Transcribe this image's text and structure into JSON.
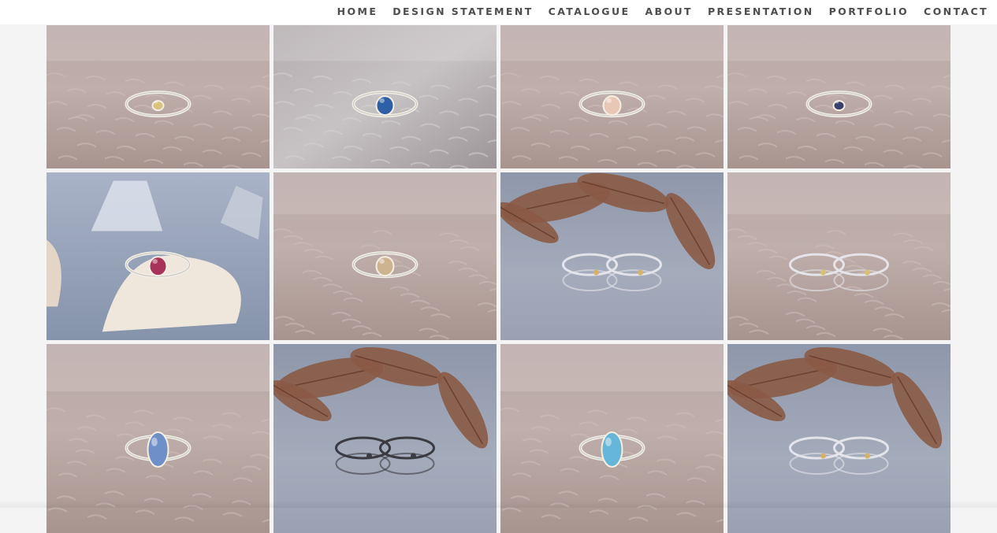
{
  "nav": {
    "items": [
      {
        "label": "HOME"
      },
      {
        "label": "DESIGN STATEMENT"
      },
      {
        "label": "CATALOGUE"
      },
      {
        "label": "ABOUT"
      },
      {
        "label": "PRESENTATION"
      },
      {
        "label": "PORTFOLIO"
      },
      {
        "label": "CONTACT"
      }
    ],
    "text_color": "#4d4d4d"
  },
  "gallery": {
    "tiles": [
      {
        "subject": "thin gold ring with small yellow stone on fur",
        "background": "fur",
        "stone": "#d9c27a"
      },
      {
        "subject": "double silver ring with blue pear stone on grey fur",
        "background": "grey-fur",
        "stone": "#2f5fa6"
      },
      {
        "subject": "split shank ring with peach stone on fur",
        "background": "fur",
        "stone": "#e9c7b5"
      },
      {
        "subject": "thin ring with dark blue oval stone on fur",
        "background": "fur",
        "stone": "#3b3f6e"
      },
      {
        "subject": "ring with pink stone on dried leaf with crystals",
        "background": "crystals",
        "stone": "#a8335a"
      },
      {
        "subject": "split shank ring with champagne stone on fur",
        "background": "fur",
        "stone": "#cdb48e"
      },
      {
        "subject": "pair of silver wire rings with beech leaves",
        "background": "leaves",
        "stone": "#d4b26a"
      },
      {
        "subject": "pair of chevron rings with gold beads on fur",
        "background": "fur",
        "stone": "#d9bf72"
      },
      {
        "subject": "ring with blue opal freeform stone on fur",
        "background": "fur",
        "stone": "#6f8fc9"
      },
      {
        "subject": "stacked oxidized rings with gold beads and leaves",
        "background": "leaves",
        "stone": "#3c3c44"
      },
      {
        "subject": "ring with blue opal pear stone on fur",
        "background": "fur",
        "stone": "#66b6d9"
      },
      {
        "subject": "pair of silver wire rings with beech leaves",
        "background": "leaves",
        "stone": "#d4b26a"
      }
    ]
  }
}
